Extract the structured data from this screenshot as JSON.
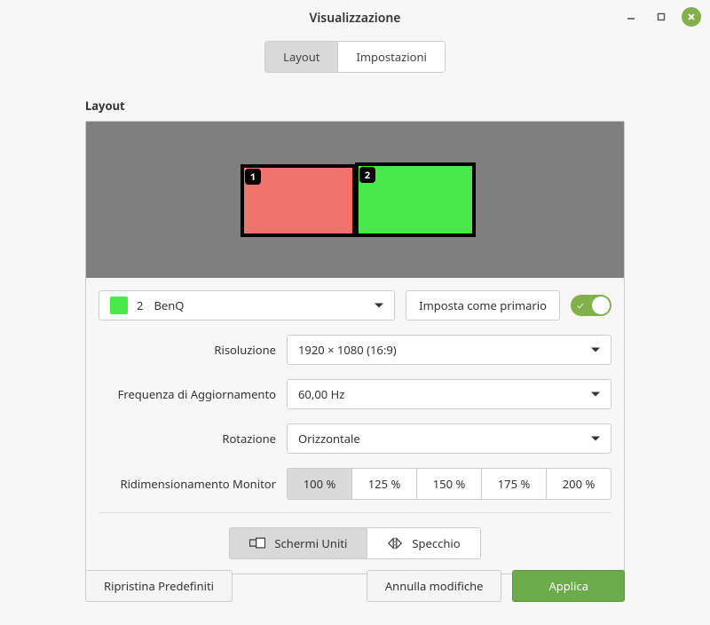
{
  "window": {
    "title": "Visualizzazione"
  },
  "tabs": {
    "layout": "Layout",
    "settings": "Impostazioni"
  },
  "section_title": "Layout",
  "monitors": {
    "badge1": "1",
    "badge2": "2"
  },
  "monitor_select": {
    "number": "2",
    "name": "BenQ",
    "primary_button": "Imposta come primario"
  },
  "fields": {
    "resolution_label": "Risoluzione",
    "resolution_value": "1920 × 1080 (16:9)",
    "refresh_label": "Frequenza di Aggiornamento",
    "refresh_value": "60,00 Hz",
    "rotation_label": "Rotazione",
    "rotation_value": "Orizzontale",
    "scale_label": "Ridimensionamento Monitor"
  },
  "scales": [
    "100 %",
    "125 %",
    "150 %",
    "175 %",
    "200 %"
  ],
  "modes": {
    "joined": "Schermi Uniti",
    "mirror": "Specchio"
  },
  "footer": {
    "restore": "Ripristina Predefiniti",
    "cancel": "Annulla modifiche",
    "apply": "Applica"
  }
}
